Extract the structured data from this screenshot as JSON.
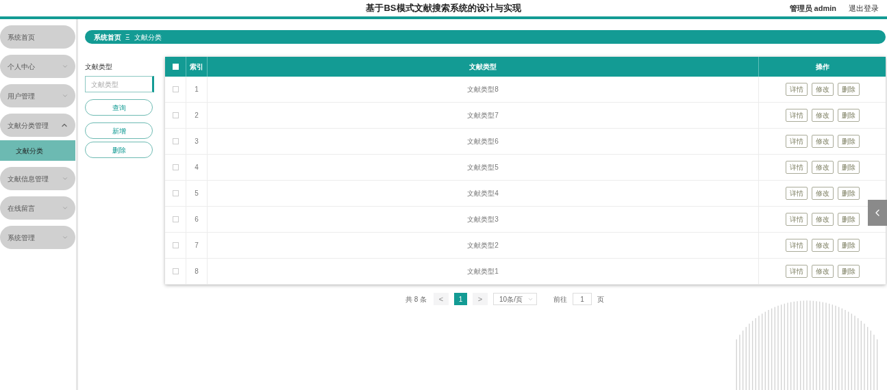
{
  "header": {
    "title": "基于BS模式文献搜索系统的设计与实现",
    "user_role": "管理员",
    "user_name": "admin",
    "logout": "退出登录"
  },
  "sidebar": {
    "items": [
      {
        "label": "系统首页",
        "kind": "link"
      },
      {
        "label": "个人中心",
        "kind": "menu",
        "expanded": false
      },
      {
        "label": "用户管理",
        "kind": "menu",
        "expanded": false
      },
      {
        "label": "文献分类管理",
        "kind": "menu",
        "expanded": true,
        "children": [
          {
            "label": "文献分类",
            "selected": true
          }
        ]
      },
      {
        "label": "文献信息管理",
        "kind": "menu",
        "expanded": false
      },
      {
        "label": "在线留言",
        "kind": "menu",
        "expanded": false
      },
      {
        "label": "系统管理",
        "kind": "menu",
        "expanded": false
      }
    ]
  },
  "breadcrumb": [
    "系统首页",
    "文献分类"
  ],
  "breadcrumb_separator": "Ξ",
  "search": {
    "label": "文献类型",
    "placeholder": "文献类型",
    "buttons": [
      "查询",
      "新增",
      "删除"
    ]
  },
  "table": {
    "select_all_checked": false,
    "columns": [
      "索引",
      "文献类型",
      "操作"
    ],
    "rows": [
      {
        "checked": false,
        "index": "1",
        "type": "文献类型8",
        "actions": [
          "详情",
          "修改",
          "删除"
        ]
      },
      {
        "checked": false,
        "index": "2",
        "type": "文献类型7",
        "actions": [
          "详情",
          "修改",
          "删除"
        ]
      },
      {
        "checked": false,
        "index": "3",
        "type": "文献类型6",
        "actions": [
          "详情",
          "修改",
          "删除"
        ]
      },
      {
        "checked": false,
        "index": "4",
        "type": "文献类型5",
        "actions": [
          "详情",
          "修改",
          "删除"
        ]
      },
      {
        "checked": false,
        "index": "5",
        "type": "文献类型4",
        "actions": [
          "详情",
          "修改",
          "删除"
        ]
      },
      {
        "checked": false,
        "index": "6",
        "type": "文献类型3",
        "actions": [
          "详情",
          "修改",
          "删除"
        ]
      },
      {
        "checked": false,
        "index": "7",
        "type": "文献类型2",
        "actions": [
          "详情",
          "修改",
          "删除"
        ]
      },
      {
        "checked": false,
        "index": "8",
        "type": "文献类型1",
        "actions": [
          "详情",
          "修改",
          "删除"
        ]
      }
    ]
  },
  "pagination": {
    "total": "共 8 条",
    "prev": "<",
    "pages": [
      {
        "label": "1",
        "selected": true
      }
    ],
    "next": ">",
    "page_size": "10条/页",
    "goto_label": "前往",
    "goto_value": "1",
    "goto_suffix": "页"
  }
}
